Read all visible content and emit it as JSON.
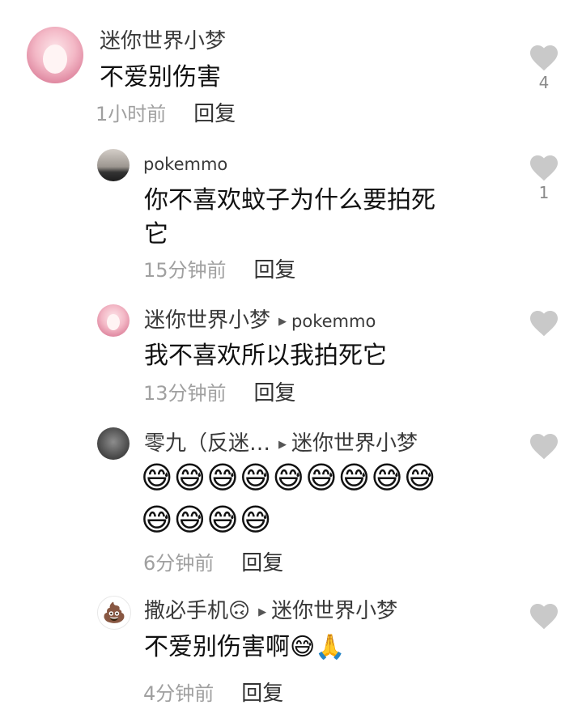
{
  "comments": [
    {
      "name": "迷你世界小梦",
      "reply_to": "",
      "text": "不爱别伤害",
      "time": "1小时前",
      "reply_label": "回复",
      "likes": "4"
    },
    {
      "name": "pokemmo",
      "reply_to": "",
      "text_line1": "你不喜欢蚊子为什么要拍死",
      "text_line2": "它",
      "time": "15分钟前",
      "reply_label": "回复",
      "likes": "1"
    },
    {
      "name": "迷你世界小梦",
      "reply_to": "pokemmo",
      "text": "我不喜欢所以我拍死它",
      "time": "13分钟前",
      "reply_label": "回复",
      "likes": ""
    },
    {
      "name": "零九（反迷…",
      "reply_to": "迷你世界小梦",
      "text_line1": "😅😅😅😅😅😅😅😅😅",
      "text_line2": "😅😅😅😅",
      "time": "6分钟前",
      "reply_label": "回复",
      "likes": ""
    },
    {
      "name": "撒必手机🙃",
      "reply_to": "迷你世界小梦",
      "text": "不爱别伤害啊😅🙏",
      "time": "4分钟前",
      "reply_label": "回复",
      "likes": ""
    }
  ],
  "icons": {
    "like": "heart-icon",
    "reply_arrow": "triangle-right-icon",
    "avatar_emoji": "💩"
  },
  "colors": {
    "heart": "#c9c9c9",
    "time_text": "#a0a0a0",
    "name_text": "#3a3a3a"
  }
}
